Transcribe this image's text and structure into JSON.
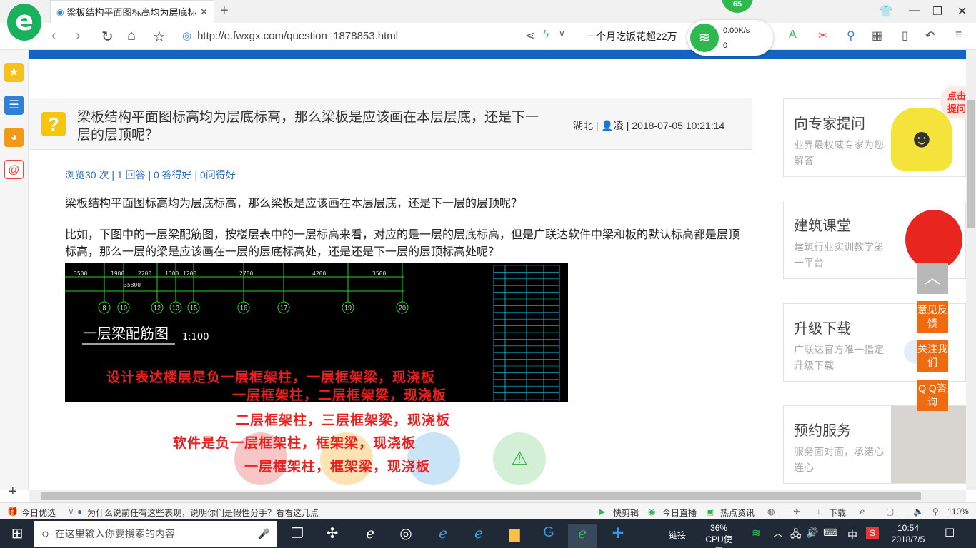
{
  "browser": {
    "tab_title": "梁板结构平面图标高均为层底标高",
    "badge": "65",
    "url": "http://e.fwxgx.com/question_1878853.html",
    "suggest": "一个月吃饭花超22万",
    "net_speed": "0.00K/s",
    "net_count": "0"
  },
  "question": {
    "title": "梁板结构平面图标高均为层底标高，那么梁板是应该画在本层层底，还是下一层的层顶呢？",
    "region": "湖北",
    "user": "凌",
    "datetime": "2018-07-05 10:21:14",
    "stats": "浏览30 次 | 1 回答 | 0 答得好 | 0问得好",
    "para1": "梁板结构平面图标高均为层底标高，那么梁板是应该画在本层层底，还是下一层的层顶呢？",
    "para2": "比如，下图中的一层梁配筋图，按楼层表中的一层标高来看，对应的是一层的层底标高，但是广联达软件中梁和板的默认标高都是层顶标高，那么一层的梁是应该画在一层的层底标高处，还是还是下一层的层顶标高处呢？"
  },
  "cad": {
    "label": "一层梁配筋图",
    "scale": "1:100",
    "axes": [
      "8",
      "10",
      "12",
      "13",
      "15",
      "16",
      "17",
      "19",
      "20"
    ],
    "dims": [
      "3500",
      "1900",
      "2200",
      "1300",
      "1200",
      "2700",
      "4200",
      "3500",
      "35800"
    ],
    "note1": "设计表达楼层是负一层框架柱，一层框架梁，现浇板",
    "note2": "一层框架柱，二层框架梁，现浇板"
  },
  "overlay_notes": {
    "n3": "二层框架柱，三层框架梁，现浇板",
    "n4": "软件是负一层框架柱，框架梁，现浇板",
    "n5": "一层框架柱，框架梁，现浇板"
  },
  "right_cards": [
    {
      "title": "向专家提问",
      "desc": "业界最权威专家为您解答"
    },
    {
      "title": "建筑课堂",
      "desc": "建筑行业实训教学第一平台"
    },
    {
      "title": "升级下载",
      "desc": "广联达官方唯一指定升级下载"
    },
    {
      "title": "预约服务",
      "desc": "服务面对面，承诺心连心"
    }
  ],
  "float_buttons": [
    "意见反馈",
    "关注我们",
    "Q Q咨询"
  ],
  "corner_tag": "点击提问",
  "status_bar": {
    "left": "今日优选",
    "news": "为什么说前任有这些表现，说明你们是假性分手？看看这几点",
    "kuaijianji": "快剪辑",
    "zhibo": "今日直播",
    "redian": "热点资讯",
    "download": "下载",
    "zoom": "110%"
  },
  "taskbar": {
    "search_placeholder": "在这里输入你要搜索的内容",
    "link": "链接",
    "cpu": "36%",
    "cpu_label": "CPU使用",
    "ime": "中",
    "time": "10:54",
    "date": "2018/7/5"
  }
}
